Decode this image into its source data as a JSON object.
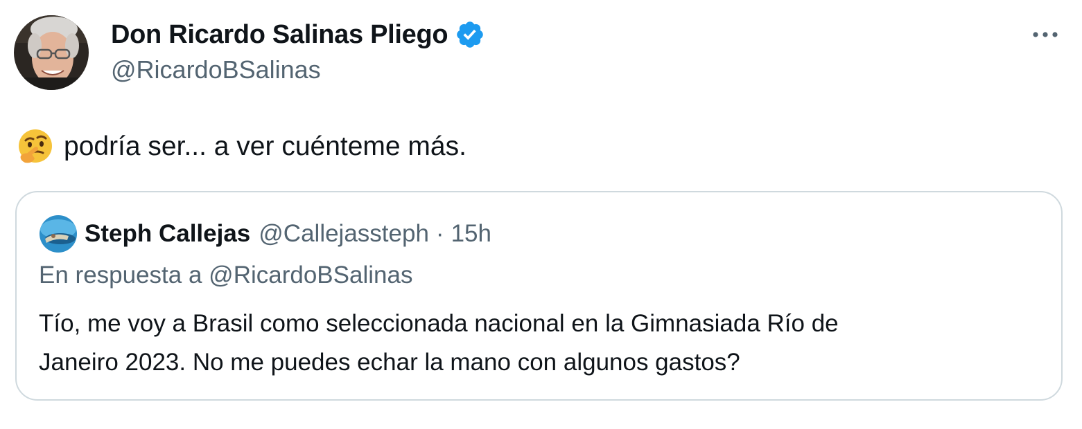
{
  "author": {
    "display_name": "Don Ricardo Salinas Pliego",
    "handle": "@RicardoBSalinas",
    "verified": true,
    "avatar_icon": "profile-photo"
  },
  "menu": {
    "icon": "more-horizontal-icon"
  },
  "tweet": {
    "emoji_icon": "thinking-face-icon",
    "text": "podría ser... a ver cuénteme más."
  },
  "quote": {
    "display_name": "Steph Callejas",
    "handle": "@Callejassteph",
    "separator": "·",
    "time": "15h",
    "reply_prefix": "En respuesta a",
    "reply_to": "@RicardoBSalinas",
    "body_lines": [
      "Tío, me voy a Brasil como seleccionada nacional en la Gimnasiada Río de",
      "Janeiro 2023. No me puedes echar la mano con algunos gastos?"
    ]
  },
  "colors": {
    "text_primary": "#0f1419",
    "text_secondary": "#536471",
    "verified_blue": "#1d9bf0",
    "card_border": "#cfd9de"
  }
}
